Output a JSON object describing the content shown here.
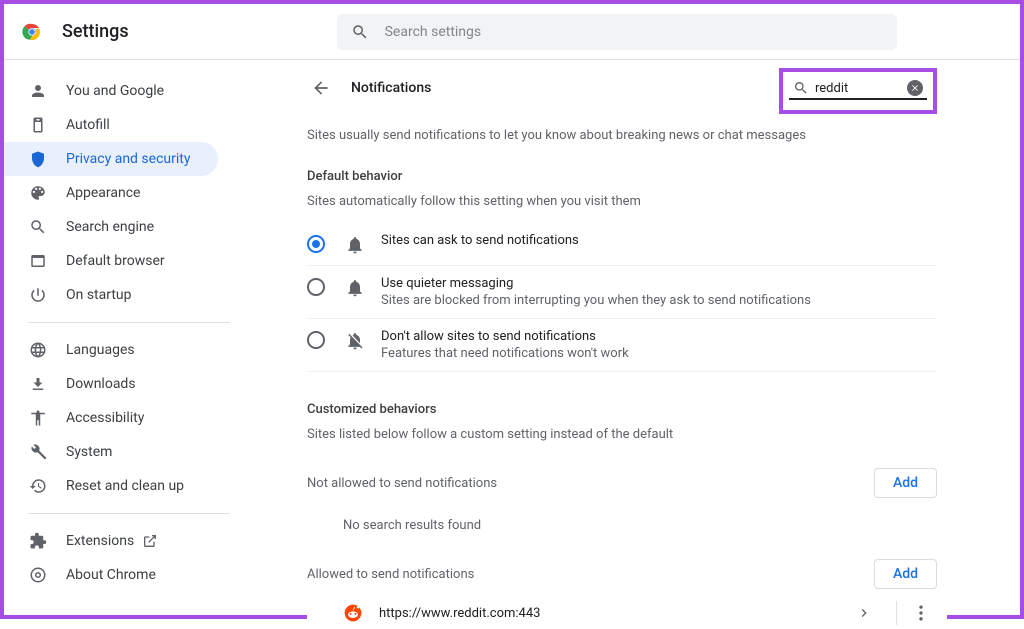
{
  "header": {
    "title": "Settings",
    "search_placeholder": "Search settings"
  },
  "sidebar": {
    "groups": [
      [
        "You and Google",
        "Autofill",
        "Privacy and security",
        "Appearance",
        "Search engine",
        "Default browser",
        "On startup"
      ],
      [
        "Languages",
        "Downloads",
        "Accessibility",
        "System",
        "Reset and clean up"
      ],
      [
        "Extensions",
        "About Chrome"
      ]
    ],
    "active": "Privacy and security"
  },
  "page": {
    "title": "Notifications",
    "filter_value": "reddit",
    "description": "Sites usually send notifications to let you know about breaking news or chat messages",
    "default_behavior_title": "Default behavior",
    "default_behavior_sub": "Sites automatically follow this setting when you visit them",
    "options": [
      {
        "label": "Sites can ask to send notifications",
        "sub": "",
        "checked": true
      },
      {
        "label": "Use quieter messaging",
        "sub": "Sites are blocked from interrupting you when they ask to send notifications",
        "checked": false
      },
      {
        "label": "Don't allow sites to send notifications",
        "sub": "Features that need notifications won't work",
        "checked": false
      }
    ],
    "customized_title": "Customized behaviors",
    "customized_sub": "Sites listed below follow a custom setting instead of the default",
    "not_allowed_label": "Not allowed to send notifications",
    "add_label": "Add",
    "no_results": "No search results found",
    "allowed_label": "Allowed to send notifications",
    "allowed_sites": [
      {
        "url": "https://www.reddit.com:443"
      }
    ]
  }
}
